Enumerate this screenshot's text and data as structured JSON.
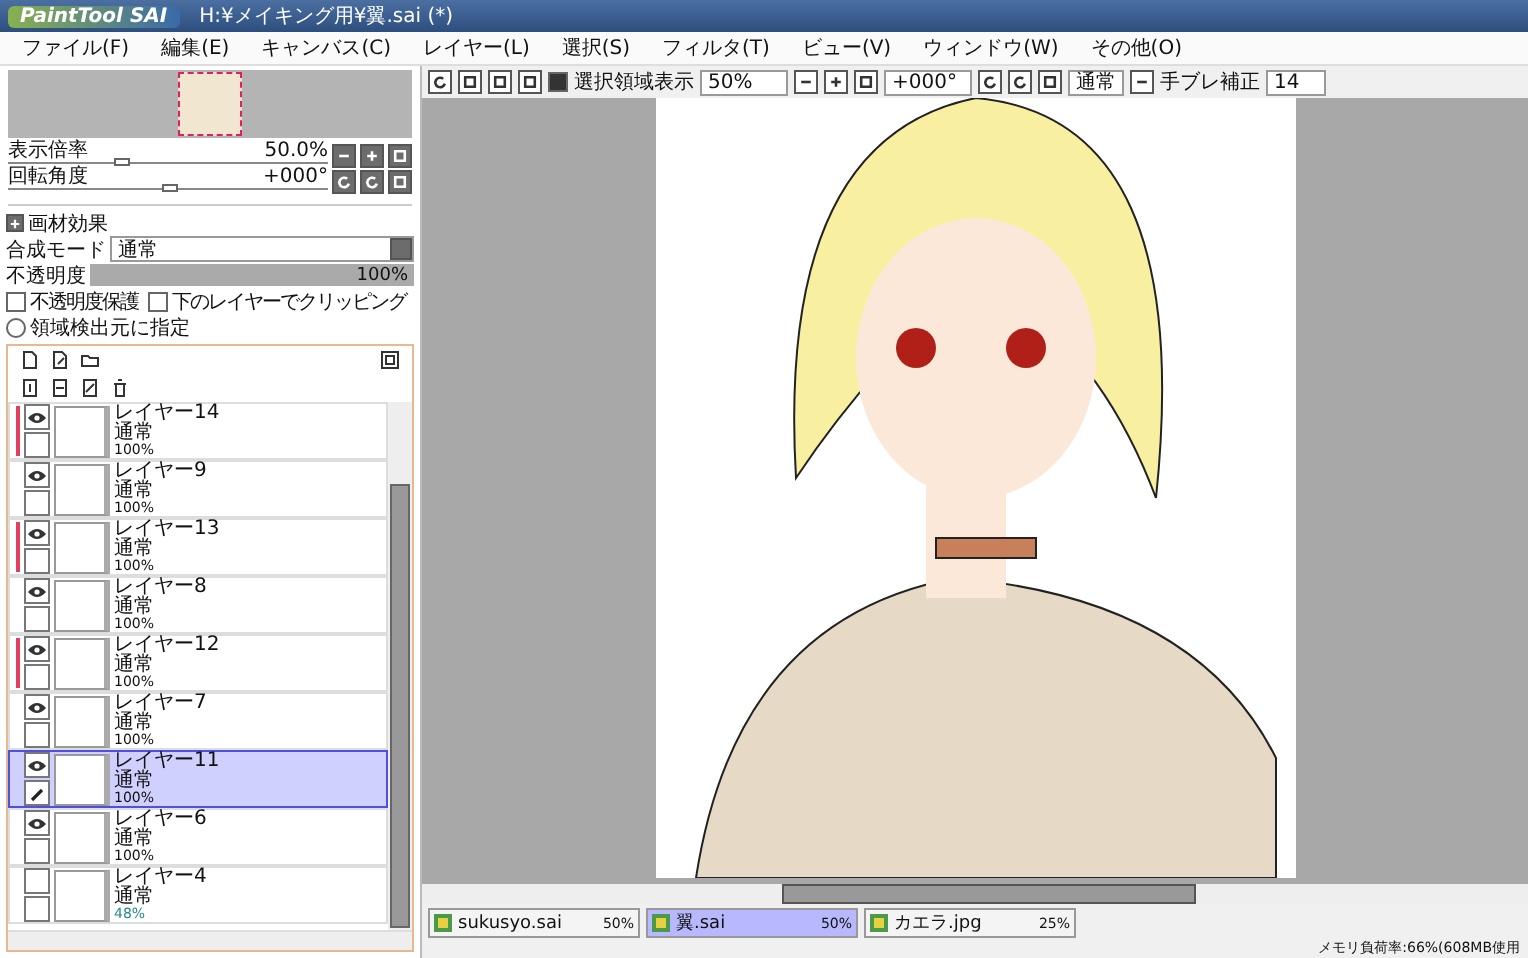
{
  "window": {
    "logo": "PaintTool SAI",
    "title": "H:¥メイキング用¥翼.sai (*)"
  },
  "menu": [
    "ファイル(F)",
    "編集(E)",
    "キャンバス(C)",
    "レイヤー(L)",
    "選択(S)",
    "フィルタ(T)",
    "ビュー(V)",
    "ウィンドウ(W)",
    "その他(O)"
  ],
  "navigator": {
    "sliders": [
      {
        "label": "表示倍率",
        "value": "50.0%",
        "level": 0.35
      },
      {
        "label": "回転角度",
        "value": "+000°",
        "level": 0.5
      }
    ]
  },
  "layer_props": {
    "effects_label": "画材効果",
    "blend_label": "合成モード",
    "blend_value": "通常",
    "opacity": {
      "label": "不透明度",
      "value": "100%",
      "level": 1
    },
    "checks": [
      {
        "label": "不透明度保護",
        "checked": false
      },
      {
        "label": "下のレイヤーでクリッピング",
        "checked": false
      }
    ],
    "radio": {
      "label": "領域検出元に指定",
      "selected": false
    }
  },
  "layers": [
    {
      "name": "レイヤー14",
      "mode": "通常",
      "opacity": "100%",
      "visible": true,
      "clipping": true,
      "selected": false
    },
    {
      "name": "レイヤー9",
      "mode": "通常",
      "opacity": "100%",
      "visible": true,
      "clipping": false,
      "selected": false
    },
    {
      "name": "レイヤー13",
      "mode": "通常",
      "opacity": "100%",
      "visible": true,
      "clipping": true,
      "selected": false
    },
    {
      "name": "レイヤー8",
      "mode": "通常",
      "opacity": "100%",
      "visible": true,
      "clipping": false,
      "selected": false
    },
    {
      "name": "レイヤー12",
      "mode": "通常",
      "opacity": "100%",
      "visible": true,
      "clipping": true,
      "selected": false
    },
    {
      "name": "レイヤー7",
      "mode": "通常",
      "opacity": "100%",
      "visible": true,
      "clipping": false,
      "selected": false
    },
    {
      "name": "レイヤー11",
      "mode": "通常",
      "opacity": "100%",
      "visible": true,
      "clipping": false,
      "selected": true
    },
    {
      "name": "レイヤー6",
      "mode": "通常",
      "opacity": "100%",
      "visible": true,
      "clipping": false,
      "selected": false
    },
    {
      "name": "レイヤー4",
      "mode": "通常",
      "opacity": "48%",
      "visible": false,
      "clipping": false,
      "selected": false
    }
  ],
  "toolbar": {
    "selection_label": "選択領域表示",
    "selection_checked": true,
    "zoom": "50%",
    "angle": "+000°",
    "blend": "通常",
    "stabilizer_label": "手ブレ補正",
    "stabilizer": "14"
  },
  "documents": [
    {
      "name": "sukusyo.sai",
      "zoom": "50%",
      "selected": false
    },
    {
      "name": "翼.sai",
      "zoom": "50%",
      "selected": true
    },
    {
      "name": "カエラ.jpg",
      "zoom": "25%",
      "selected": false
    }
  ],
  "status_bar": "メモリ負荷率:66%(608MB使用"
}
